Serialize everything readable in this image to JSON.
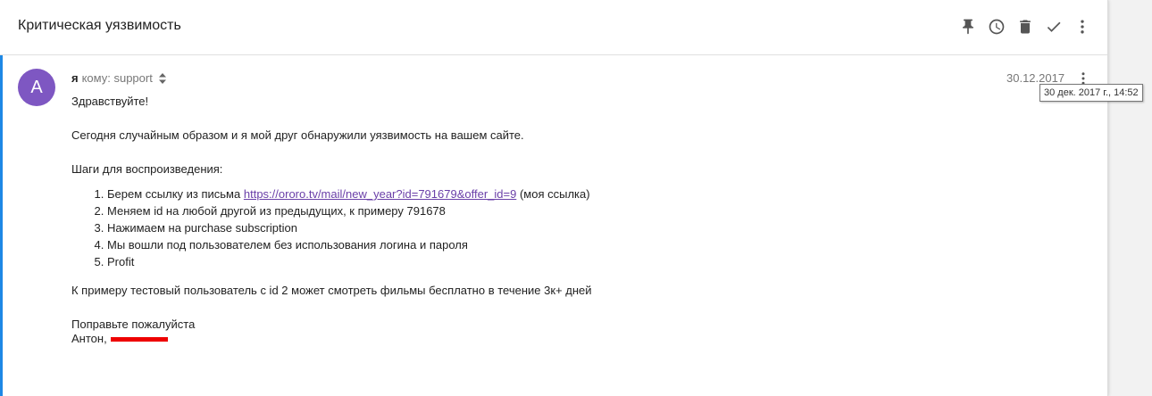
{
  "header": {
    "subject": "Критическая уязвимость",
    "toolbar": [
      {
        "icon": "pin-icon"
      },
      {
        "icon": "snooze-clock-icon"
      },
      {
        "icon": "trash-icon"
      },
      {
        "icon": "check-icon"
      },
      {
        "icon": "more-vert-icon"
      }
    ]
  },
  "message": {
    "avatar_letter": "A",
    "avatar_color": "#7e57c2",
    "sender": "я",
    "recipient": "кому: support",
    "date": "30.12.2017",
    "date_tooltip": "30 дек. 2017 г., 14:52",
    "body": {
      "greeting": "Здравствуйте!",
      "found": "Сегодня случайным образом и я мой друг обнаружили уязвимость на вашем сайте.",
      "steps_title": "Шаги для воспроизведения:",
      "step1_prefix": "Берем ссылку из письма",
      "step1_link": "https://ororo.tv/mail/new_year?id=791679&offer_id=9",
      "step1_suffix": "(моя ссылка)",
      "step2": "Меняем id на любой другой из предыдущих, к примеру 791678",
      "step3": "Нажимаем на purchase subscription",
      "step4": "Мы вошли под пользователем без использования логина и пароля",
      "step5": "Profit",
      "example": "К примеру тестовый пользователь с id 2 может смотреть фильмы бесплатно в течение 3к+ дней",
      "fix": "Поправьте пожалуйста",
      "signature": "Антон,"
    }
  },
  "colors": {
    "accent": "#1e88e5",
    "link": "#6a3fa8",
    "redaction": "#e00000"
  }
}
